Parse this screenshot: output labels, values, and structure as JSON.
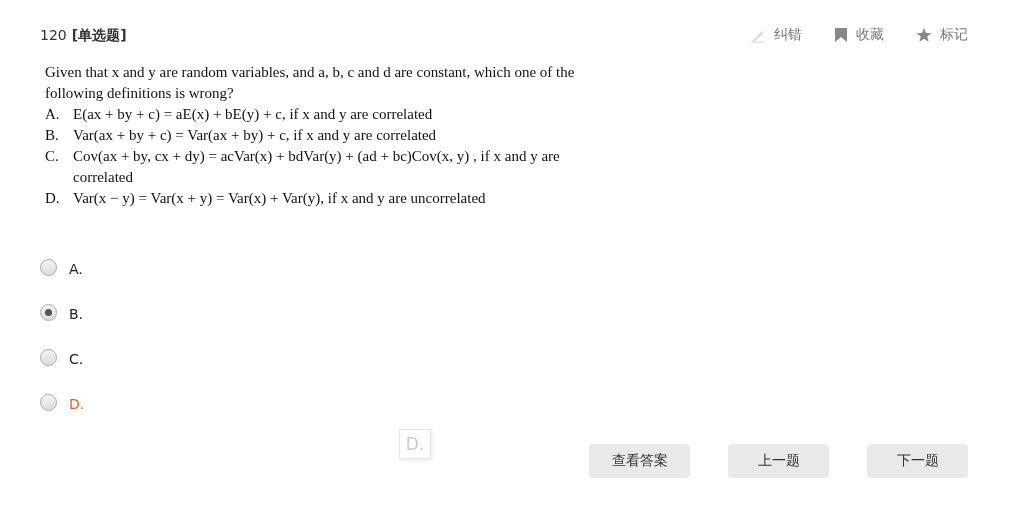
{
  "header": {
    "number": "120",
    "type": "[单选题]",
    "actions": [
      {
        "kind": "pencil",
        "label": "纠错"
      },
      {
        "kind": "bookmark",
        "label": "收藏"
      },
      {
        "kind": "star",
        "label": "标记"
      }
    ]
  },
  "question": {
    "stem": "Given that x and y are random variables, and a, b, c and d are constant, which one of the following definitions is wrong?",
    "choices": [
      {
        "letter": "A.",
        "text": "E(ax + by + c) = aE(x) + bE(y) + c, if x and y are correlated"
      },
      {
        "letter": "B.",
        "text": "Var(ax + by + c) = Var(ax + by) + c, if x and y are correlated"
      },
      {
        "letter": "C.",
        "text": "Cov(ax + by, cx + dy) = acVar(x) + bdVar(y) + (ad + bc)Cov(x, y) ,  if  x and y are correlated"
      },
      {
        "letter": "D.",
        "text": "Var(x − y) = Var(x + y) = Var(x) + Var(y), if x and y are uncorrelated"
      }
    ]
  },
  "options": [
    {
      "label": "A.",
      "selected": false,
      "highlighted": false
    },
    {
      "label": "B.",
      "selected": true,
      "highlighted": false
    },
    {
      "label": "C.",
      "selected": false,
      "highlighted": false
    },
    {
      "label": "D.",
      "selected": false,
      "highlighted": true
    }
  ],
  "drag_ghost": "D.",
  "buttons": [
    "查看答案",
    "上一题",
    "下一题"
  ]
}
